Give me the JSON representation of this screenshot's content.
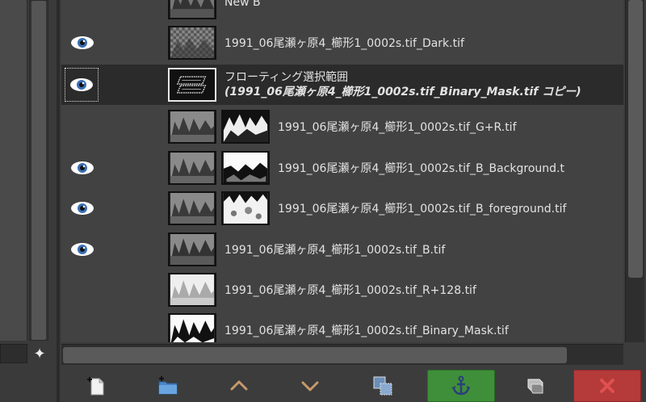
{
  "layers": [
    {
      "name": "New B",
      "visible": false,
      "thumb": "forest-gray",
      "mask": null,
      "selected": false
    },
    {
      "name": "1991_06尾瀬ヶ原4_櫛形1_0002s.tif_Dark.tif",
      "visible": true,
      "thumb": "checker",
      "mask": null,
      "selected": false
    },
    {
      "name_line1": "フローティング選択範囲",
      "name_line2": "(1991_06尾瀬ヶ原4_櫛形1_0002s.tif_Binary_Mask.tif",
      "name_line2_suffix": " コピー)",
      "visible": true,
      "thumb": "floating-selection",
      "mask": null,
      "selected": true
    },
    {
      "name": "1991_06尾瀬ヶ原4_櫛形1_0002s.tif_G+R.tif",
      "visible": false,
      "thumb": "forest-gray",
      "mask": "mask-dark",
      "selected": false
    },
    {
      "name": "1991_06尾瀬ヶ原4_櫛形1_0002s.tif_B_Background.t",
      "visible": true,
      "thumb": "forest-gray",
      "mask": "mask-horizon",
      "selected": false
    },
    {
      "name": "1991_06尾瀬ヶ原4_櫛形1_0002s.tif_B_foreground.tif",
      "visible": true,
      "thumb": "forest-gray",
      "mask": "mask-bright",
      "selected": false
    },
    {
      "name": "1991_06尾瀬ヶ原4_櫛形1_0002s.tif_B.tif",
      "visible": true,
      "thumb": "forest-gray",
      "mask": null,
      "selected": false
    },
    {
      "name": "1991_06尾瀬ヶ原4_櫛形1_0002s.tif_R+128.tif",
      "visible": false,
      "thumb": "forest-light",
      "mask": null,
      "selected": false
    },
    {
      "name": "1991_06尾瀬ヶ原4_櫛形1_0002s.tif_Binary_Mask.tif",
      "visible": false,
      "thumb": "forest-binary",
      "mask": null,
      "selected": false
    }
  ],
  "toolbar": {
    "buttons": [
      {
        "icon": "new-layer-icon"
      },
      {
        "icon": "new-layer-group-icon"
      },
      {
        "icon": "raise-layer-icon"
      },
      {
        "icon": "lower-layer-icon"
      },
      {
        "icon": "duplicate-layer-icon"
      },
      {
        "icon": "anchor-layer-icon"
      },
      {
        "icon": "merge-layer-icon"
      },
      {
        "icon": "delete-layer-icon"
      }
    ]
  },
  "colors": {
    "eye": "#3a6fb5",
    "anchor_bg": "#3f8f3a",
    "delete_bg": "#b53a3a",
    "arrow": "#c79a6a"
  }
}
